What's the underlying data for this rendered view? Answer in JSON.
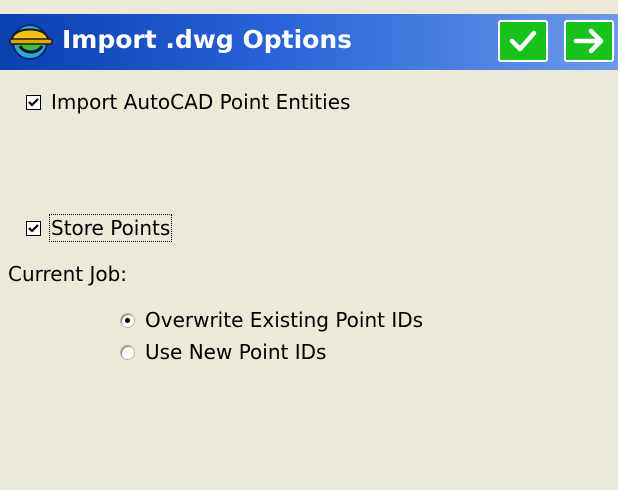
{
  "window": {
    "title": "Import .dwg Options",
    "icon": "hardhat-app-icon",
    "ok_icon": "checkmark-icon",
    "next_icon": "arrow-right-icon",
    "colors": {
      "titlebar_start": "#0a3fb0",
      "titlebar_end": "#6a9ae8",
      "button_green": "#17c21d",
      "background": "#ece9d8"
    }
  },
  "options": {
    "import_point_entities": {
      "label": "Import AutoCAD Point Entities",
      "checked": true
    },
    "store_points": {
      "label": "Store Points",
      "checked": true
    }
  },
  "current_job": {
    "label": "Current Job:",
    "choices": [
      {
        "label": "Overwrite Existing Point IDs",
        "selected": true
      },
      {
        "label": "Use New Point IDs",
        "selected": false
      }
    ]
  }
}
